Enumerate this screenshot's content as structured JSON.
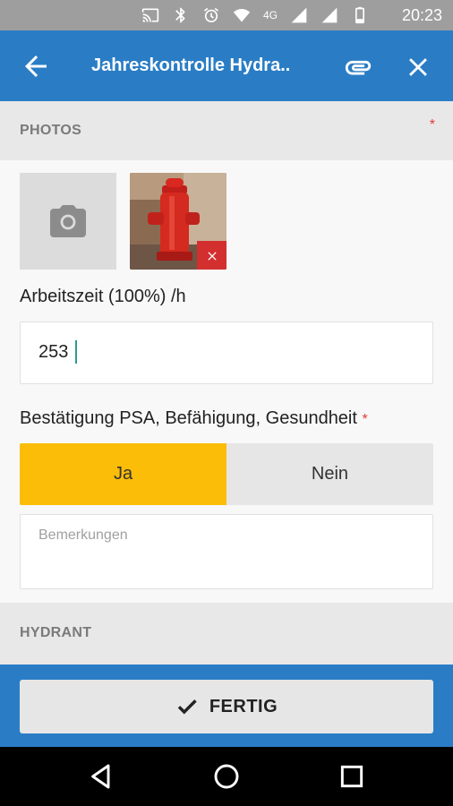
{
  "status_bar": {
    "network": "4G",
    "time": "20:23"
  },
  "app_bar": {
    "title": "Jahreskontrolle Hydra.."
  },
  "sections": {
    "photos_label": "PHOTOS",
    "photos_required_mark": "*",
    "hydrant_label": "HYDRANT"
  },
  "fields": {
    "arbeitszeit": {
      "label": "Arbeitszeit (100%) /h",
      "value": "253"
    },
    "psa": {
      "label": "Bestätigung PSA, Befähigung, Gesundheit",
      "required_mark": "*",
      "options": [
        "Ja",
        "Nein"
      ],
      "selected": "Ja"
    },
    "bemerkungen": {
      "placeholder": "Bemerkungen"
    }
  },
  "footer": {
    "done_label": "FERTIG"
  },
  "colors": {
    "primary": "#2a7dc5",
    "selected": "#fbbd08",
    "required": "#e53935",
    "delete": "#d32f2f"
  }
}
